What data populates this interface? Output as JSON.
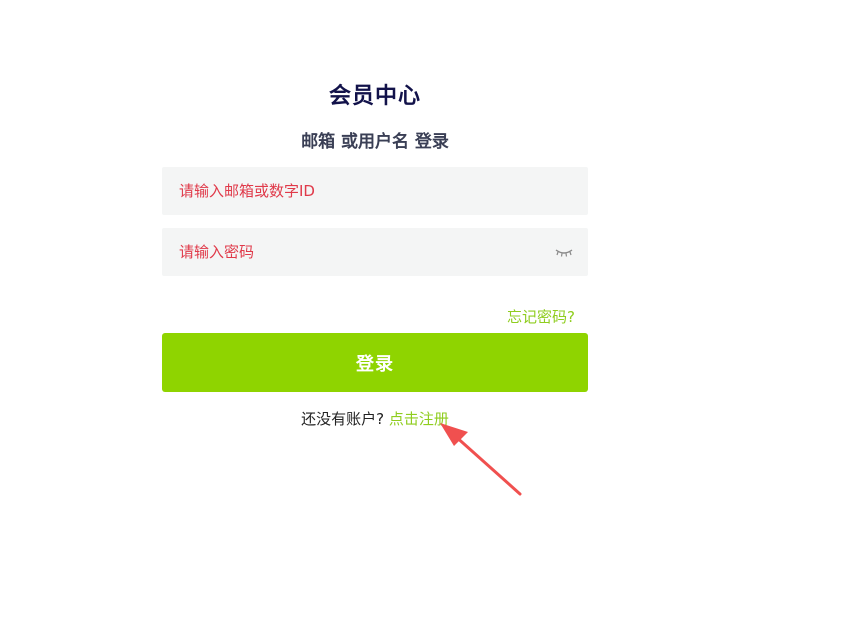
{
  "header": {
    "title": "会员中心",
    "subtitle": "邮箱 或用户名 登录"
  },
  "form": {
    "email_placeholder": "请输入邮箱或数字ID",
    "password_placeholder": "请输入密码",
    "password_toggle_icon": "eye-closed-icon",
    "forgot_label": "忘记密码?",
    "login_label": "登录"
  },
  "register": {
    "prompt": "还没有账户?",
    "link_label": "点击注册"
  },
  "colors": {
    "accent": "#8fd400",
    "link": "#8fcd1f",
    "placeholder": "#e03a4a",
    "annotation_arrow": "#f0504f"
  }
}
